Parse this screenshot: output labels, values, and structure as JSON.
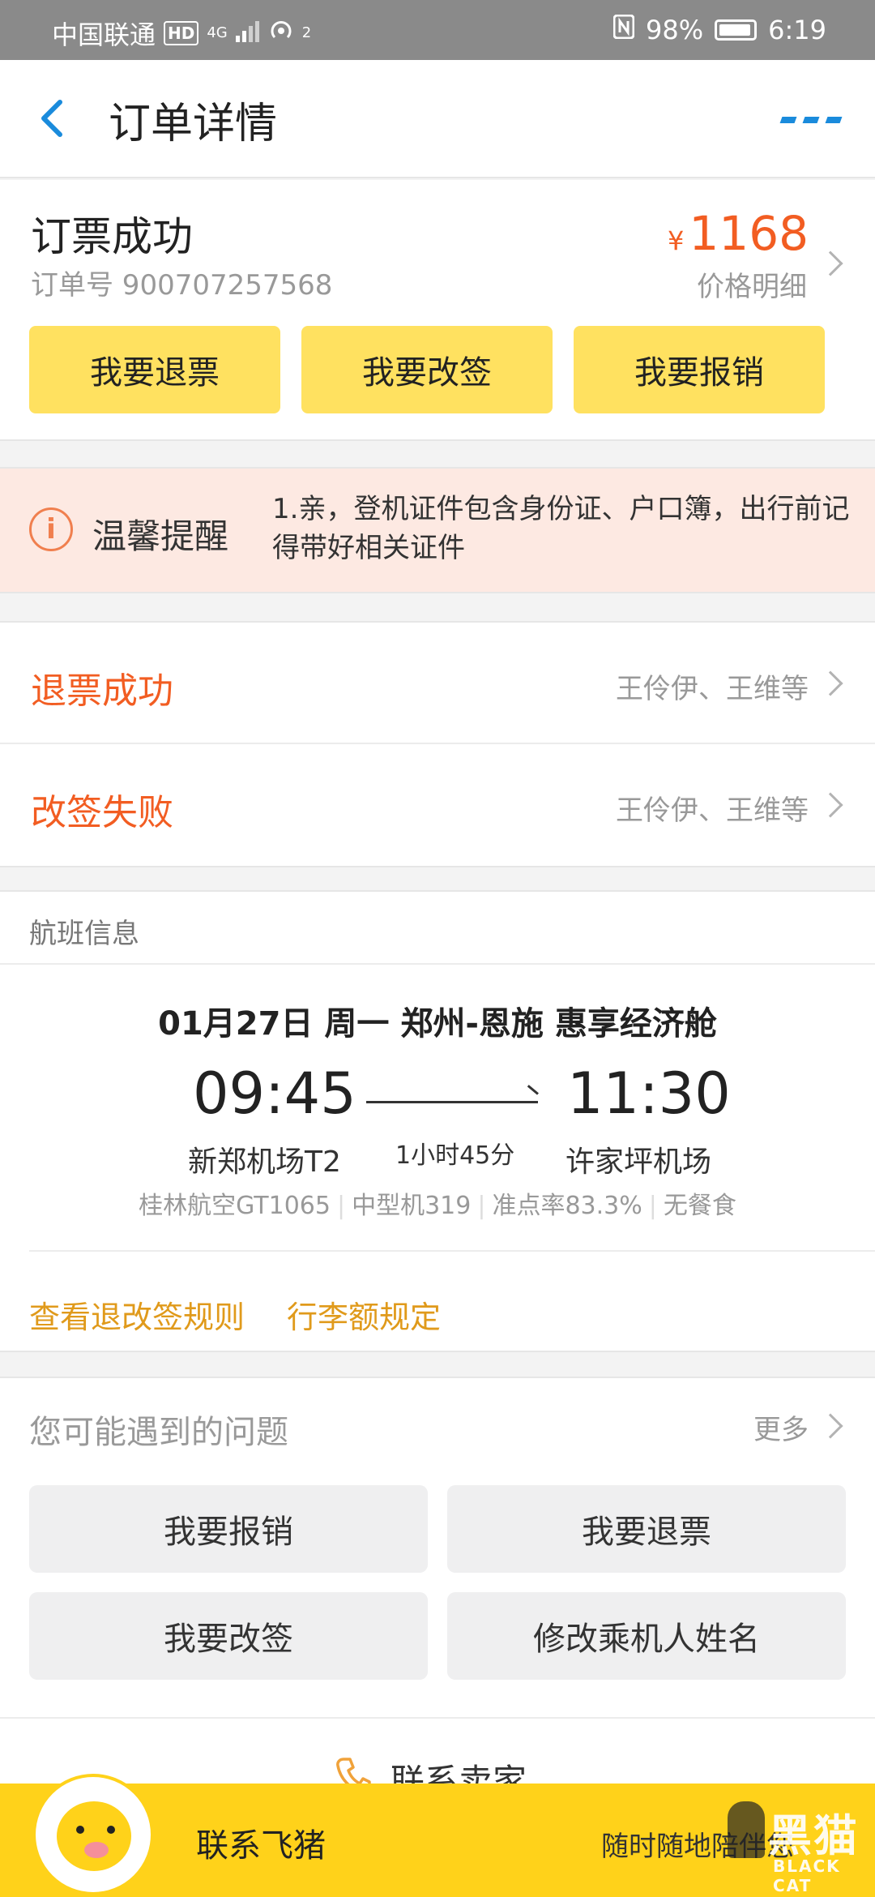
{
  "status_bar": {
    "carrier": "中国联通",
    "hd": "HD",
    "network": "4G",
    "hotspot_count": "2",
    "battery": "98%",
    "time": "6:19"
  },
  "nav": {
    "title": "订单详情"
  },
  "order": {
    "status": "订票成功",
    "order_no": "订单号 900707257568",
    "currency": "¥",
    "price": "1168",
    "price_detail": "价格明细",
    "actions": [
      "我要退票",
      "我要改签",
      "我要报销"
    ]
  },
  "reminder": {
    "title": "温馨提醒",
    "text": "1.亲，登机证件包含身份证、户口簿，出行前记得带好相关证件"
  },
  "status_rows": [
    {
      "title": "退票成功",
      "people": "王伶伊、王维等"
    },
    {
      "title": "改签失败",
      "people": "王伶伊、王维等"
    }
  ],
  "flight": {
    "header": "航班信息",
    "route": "01月27日 周一 郑州-恩施 惠享经济舱",
    "dep_time": "09:45",
    "arr_time": "11:30",
    "duration": "1小时45分",
    "dep_airport": "新郑机场T2",
    "arr_airport": "许家坪机场",
    "meta": [
      "桂林航空GT1065",
      "中型机319",
      "准点率83.3%",
      "无餐食"
    ],
    "links": [
      "查看退改签规则",
      "行李额规定"
    ]
  },
  "faq": {
    "title": "您可能遇到的问题",
    "more": "更多",
    "items": [
      "我要报销",
      "我要退票",
      "我要改签",
      "修改乘机人姓名"
    ]
  },
  "contact_seller": {
    "label": "联系卖家"
  },
  "bottom_bar": {
    "title": "联系飞猪",
    "subtitle": "随时随地陪伴您"
  },
  "watermark": {
    "cn": "黑猫",
    "en": "BLACK CAT"
  },
  "colors": {
    "accent_orange": "#f25d22",
    "button_yellow": "#ffe160",
    "link_gold": "#e09a1b",
    "nav_blue": "#1a8bdc",
    "bottom_yellow": "#ffd21a"
  }
}
